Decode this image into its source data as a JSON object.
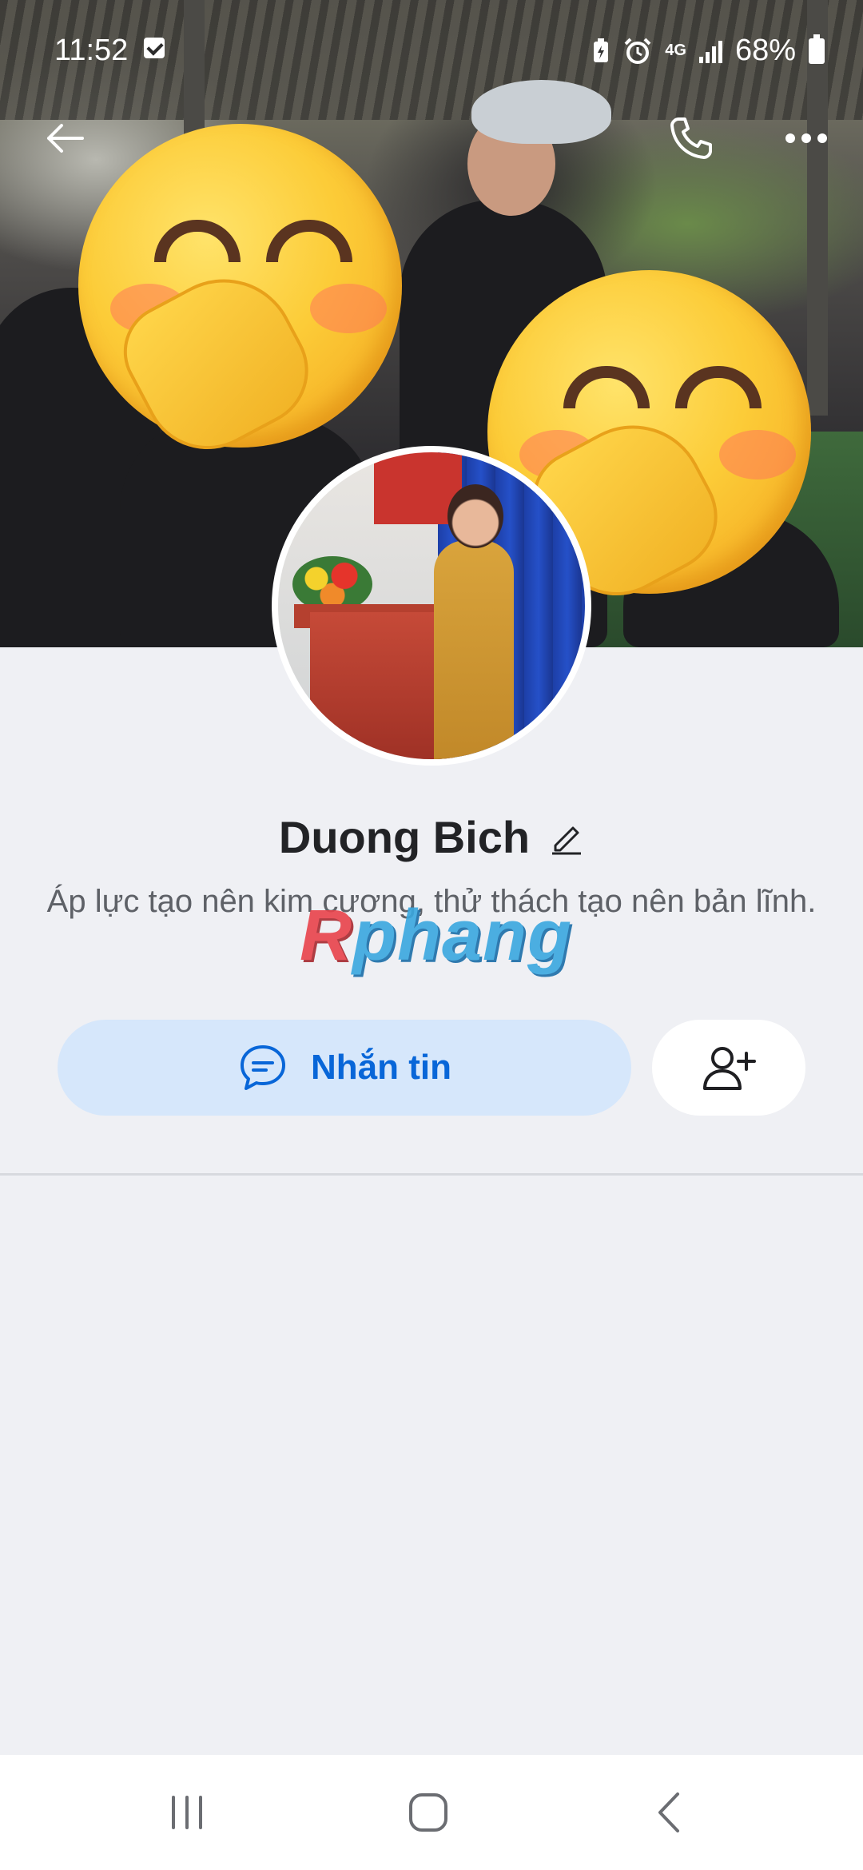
{
  "status_bar": {
    "time": "11:52",
    "network": "4G",
    "battery": "68%",
    "icons": [
      "checkbox-icon",
      "battery-saver-icon",
      "alarm-icon",
      "network-4g-icon",
      "signal-icon",
      "battery-icon"
    ]
  },
  "top_nav": {
    "back_icon": "arrow-left-icon",
    "call_icon": "phone-icon",
    "more_icon": "more-dots-icon"
  },
  "profile": {
    "name": "Duong Bich",
    "edit_icon": "pencil-icon",
    "bio": "Áp lực tạo nên kim cương, thử thách tạo nên bản lĩnh."
  },
  "watermark": {
    "first_letter": "R",
    "rest": "phang"
  },
  "actions": {
    "message_label": "Nhắn tin",
    "message_icon": "chat-bubble-icon",
    "add_friend_icon": "add-user-icon"
  },
  "system_nav": {
    "recents_icon": "recents-icon",
    "home_icon": "home-icon",
    "back_icon": "back-chevron-icon"
  },
  "colors": {
    "accent": "#0866d8",
    "message_button_bg": "#d6e7fb",
    "page_bg": "#eff0f4",
    "text_primary": "#222326",
    "text_secondary": "#5e6167"
  }
}
